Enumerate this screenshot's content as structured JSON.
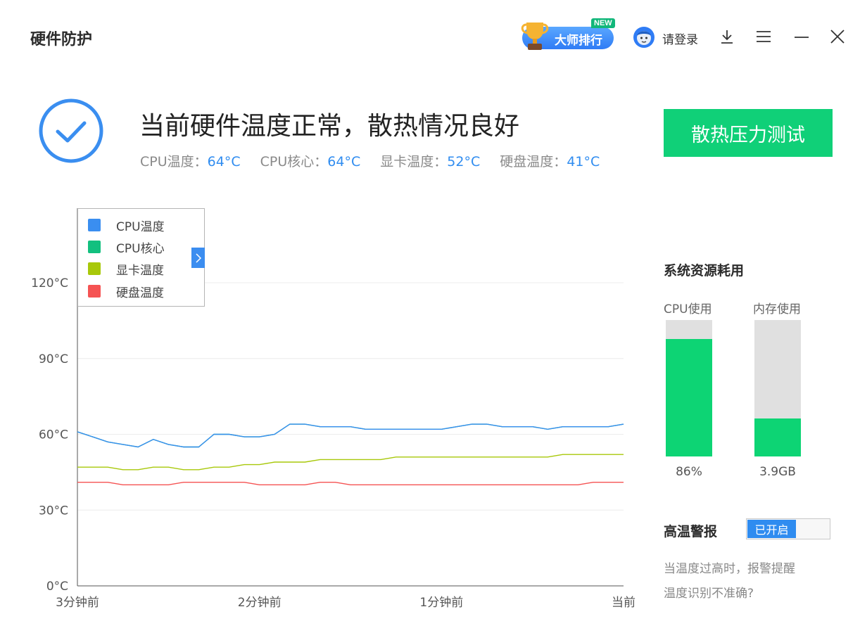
{
  "app": {
    "title": "硬件防护"
  },
  "header": {
    "rank_label": "大师排行",
    "new_badge": "NEW",
    "login_label": "请登录"
  },
  "status": {
    "headline": "当前硬件温度正常，散热情况良好",
    "temps": [
      {
        "label": "CPU温度：",
        "value": "64°C"
      },
      {
        "label": "CPU核心：",
        "value": "64°C"
      },
      {
        "label": "显卡温度：",
        "value": "52°C"
      },
      {
        "label": "硬盘温度：",
        "value": "41°C"
      }
    ]
  },
  "stress_test": {
    "label": "散热压力测试"
  },
  "chart_data": {
    "type": "line",
    "y_ticks": [
      "120°C",
      "90°C",
      "60°C",
      "30°C",
      "0°C"
    ],
    "x_ticks": [
      "3分钟前",
      "2分钟前",
      "1分钟前",
      "当前"
    ],
    "ylim": [
      0,
      120
    ],
    "y_unit": "°C",
    "grid": true,
    "x": [
      0,
      5,
      10,
      15,
      20,
      25,
      30,
      35,
      40,
      45,
      50,
      55,
      60,
      65,
      70,
      75,
      80,
      85,
      90,
      95,
      100,
      105,
      110,
      115,
      120,
      125,
      130,
      135,
      140,
      145,
      150,
      155,
      160,
      165,
      170,
      175,
      180
    ],
    "legend": [
      {
        "name": "CPU温度",
        "color": "#3a8ef0"
      },
      {
        "name": "CPU核心",
        "color": "#13c07f"
      },
      {
        "name": "显卡温度",
        "color": "#a8c80a"
      },
      {
        "name": "硬盘温度",
        "color": "#f55353"
      }
    ],
    "series": [
      {
        "name": "CPU温度",
        "color": "#3a8ef0",
        "values": [
          61,
          59,
          57,
          56,
          55,
          58,
          56,
          55,
          55,
          60,
          60,
          59,
          59,
          60,
          64,
          64,
          63,
          63,
          63,
          62,
          62,
          62,
          62,
          62,
          62,
          63,
          64,
          64,
          63,
          63,
          63,
          62,
          63,
          63,
          63,
          63,
          64
        ]
      },
      {
        "name": "CPU核心",
        "color": "#13c07f",
        "values": [
          61,
          59,
          57,
          56,
          55,
          58,
          56,
          55,
          55,
          60,
          60,
          59,
          59,
          60,
          64,
          64,
          63,
          63,
          63,
          62,
          62,
          62,
          62,
          62,
          62,
          63,
          64,
          64,
          63,
          63,
          63,
          62,
          63,
          63,
          63,
          63,
          64
        ]
      },
      {
        "name": "显卡温度",
        "color": "#a8c80a",
        "values": [
          47,
          47,
          47,
          46,
          46,
          47,
          47,
          46,
          46,
          47,
          47,
          48,
          48,
          49,
          49,
          49,
          50,
          50,
          50,
          50,
          50,
          51,
          51,
          51,
          51,
          51,
          51,
          51,
          51,
          51,
          51,
          51,
          52,
          52,
          52,
          52,
          52
        ]
      },
      {
        "name": "硬盘温度",
        "color": "#f55353",
        "values": [
          41,
          41,
          41,
          40,
          40,
          40,
          40,
          41,
          41,
          41,
          41,
          41,
          40,
          40,
          40,
          40,
          41,
          41,
          40,
          40,
          40,
          40,
          40,
          40,
          40,
          40,
          40,
          40,
          40,
          40,
          40,
          40,
          40,
          40,
          41,
          41,
          41
        ]
      }
    ]
  },
  "resources": {
    "title": "系统资源耗用",
    "cpu": {
      "label": "CPU使用",
      "value": "86%",
      "fraction": 0.86
    },
    "memory": {
      "label": "内存使用",
      "value": "3.9GB",
      "fraction": 0.28
    }
  },
  "alarm": {
    "title": "高温警报",
    "toggle_label": "已开启",
    "hint": "当温度过高时，报警提醒",
    "accuracy_link": "温度识别不准确?"
  }
}
